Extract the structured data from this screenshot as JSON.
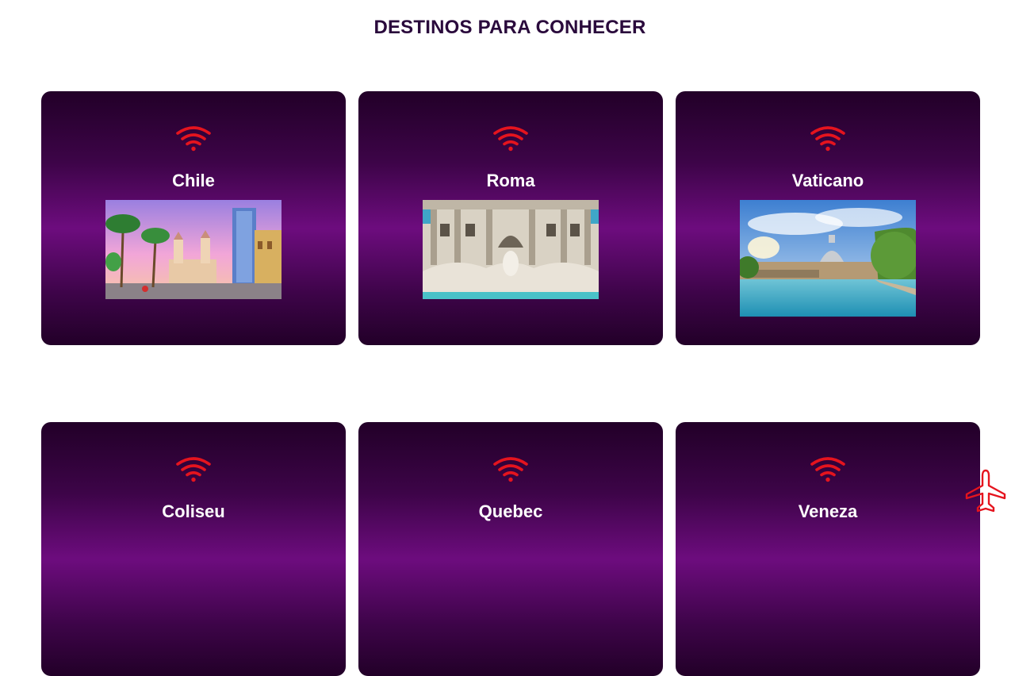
{
  "page": {
    "title": "DESTINOS PARA CONHECER"
  },
  "destinations": [
    {
      "name": "Chile",
      "icon": "wifi-icon",
      "image": "chile-photo"
    },
    {
      "name": "Roma",
      "icon": "wifi-icon",
      "image": "trevi-fountain-photo"
    },
    {
      "name": "Vaticano",
      "icon": "wifi-icon",
      "image": "vatican-river-photo"
    },
    {
      "name": "Coliseu",
      "icon": "wifi-icon"
    },
    {
      "name": "Quebec",
      "icon": "wifi-icon"
    },
    {
      "name": "Veneza",
      "icon": "wifi-icon"
    }
  ],
  "floating_button": {
    "icon": "airplane-icon"
  },
  "colors": {
    "title": "#2a0a3c",
    "card_dark": "#220028",
    "card_mid": "#6d0c7e",
    "icon_red": "#e5141e",
    "card_text": "#ffffff"
  }
}
